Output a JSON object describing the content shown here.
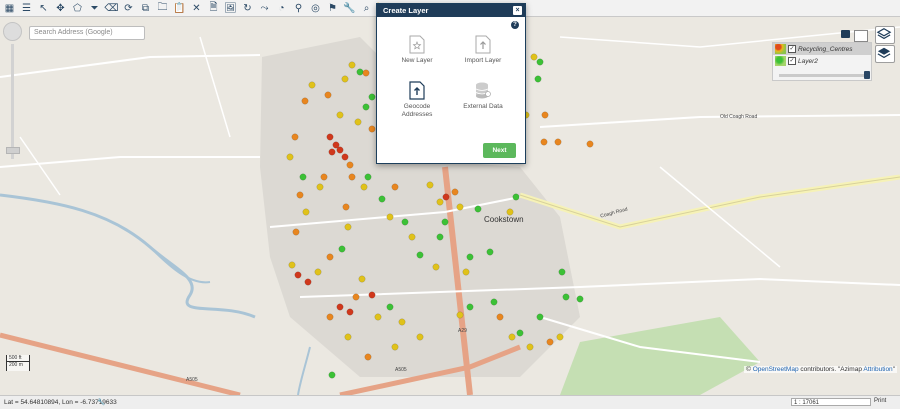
{
  "toolbar": {
    "icons": [
      "map-icon",
      "layers-icon",
      "select-arrow-icon",
      "move-icon",
      "draw-shape-icon",
      "filter-icon",
      "erase-icon",
      "refresh-icon",
      "copy-icon",
      "folder-icon",
      "clipboard-icon",
      "close-icon",
      "document-icon",
      "image-icon",
      "rotate-icon",
      "route-icon",
      "chart-icon",
      "user-search-icon",
      "compass-icon",
      "marker-icon",
      "wrench-icon",
      "search-zoom-icon",
      "measure-icon",
      "table-icon",
      "heart-marker-icon"
    ]
  },
  "search": {
    "placeholder": "Search Address (Google)"
  },
  "dialog": {
    "title": "Create Layer",
    "close": "×",
    "help": "?",
    "options": [
      {
        "label": "New Layer",
        "icon": "new-layer-icon"
      },
      {
        "label": "Import Layer",
        "icon": "import-layer-icon"
      },
      {
        "label": "Geocode Addresses",
        "icon": "geocode-icon"
      },
      {
        "label": "External Data",
        "icon": "external-data-icon"
      }
    ],
    "next": "Next"
  },
  "layers": {
    "items": [
      {
        "name": "Recycling_Centres",
        "checked": true
      },
      {
        "name": "Layer2",
        "checked": true
      }
    ]
  },
  "map": {
    "town_label": "Cookstown",
    "road_labels": [
      "Coagh Road",
      "Old Coagh Road",
      "A505",
      "A29",
      "A505"
    ]
  },
  "attribution": {
    "prefix": "©",
    "osm": "OpenStreetMap",
    "middle": "contributors. \"Azimap",
    "attr": "Attribution",
    "suffix": "\""
  },
  "scalebar": {
    "top": "500 ft",
    "bottom": "200 m"
  },
  "status": {
    "coords": "Lat = 54.64810894, Lon = -6.73719633",
    "scale": "1 : 17061",
    "print": "Print"
  },
  "colors": {
    "header": "#1f3c59",
    "next": "#5cb85c",
    "red": "#d0381c",
    "orange": "#e8861f",
    "yellow": "#e0c21a",
    "green": "#3cc136"
  }
}
